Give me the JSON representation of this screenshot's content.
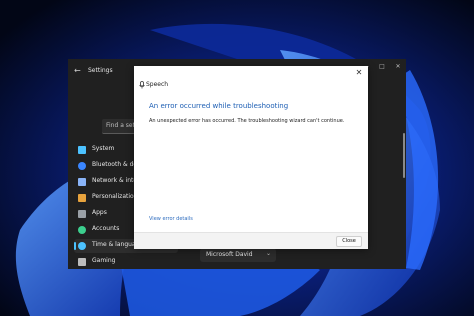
{
  "settings": {
    "title": "Settings",
    "search_placeholder": "Find a setting",
    "nav": [
      {
        "label": "System",
        "color": "#4cc2ff"
      },
      {
        "label": "Bluetooth & de",
        "color": "#3a86ff"
      },
      {
        "label": "Network & inte",
        "color": "#8ab4f8"
      },
      {
        "label": "Personalization",
        "color": "#e8a33d"
      },
      {
        "label": "Apps",
        "color": "#9aa0a6"
      },
      {
        "label": "Accounts",
        "color": "#3ccf8e"
      },
      {
        "label": "Time & language",
        "color": "#4cc2ff"
      },
      {
        "label": "Gaming",
        "color": "#bdbdbd"
      }
    ],
    "selected_nav": "Time & language",
    "voice_value": "Microsoft David",
    "accent": "#4cc2ff"
  },
  "dialog": {
    "app_name": "Speech",
    "heading": "An error occurred while troubleshooting",
    "message": "An unexpected error has occurred. The troubleshooting wizard can't continue.",
    "link": "View error details",
    "close_button": "Close",
    "heading_color": "#1e5fb4"
  },
  "icons": {
    "back": "back-arrow-icon",
    "close": "close-icon",
    "mic": "microphone-icon",
    "chevron": "chevron-down-icon"
  }
}
